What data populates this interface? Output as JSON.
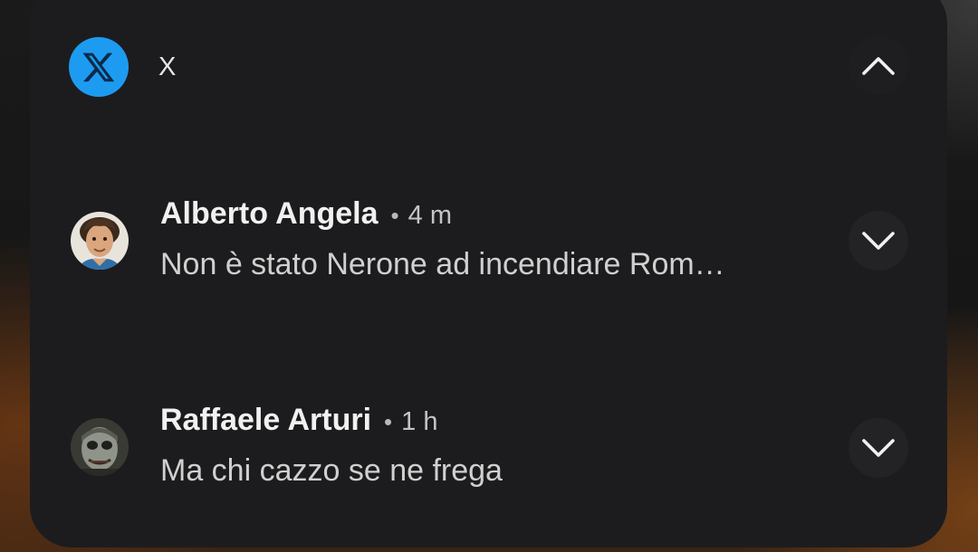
{
  "app": {
    "name": "X",
    "icon": "x-logo-icon",
    "icon_color": "#1d9bf0"
  },
  "controls": {
    "collapse_icon": "chevron-up-icon",
    "expand_icon": "chevron-down-icon"
  },
  "notifications": [
    {
      "sender": "Alberto Angela",
      "separator": "•",
      "time": "4 m",
      "message": "Non è stato Nerone ad incendiare Rom…",
      "avatar": "avatar-alberto-angela"
    },
    {
      "sender": "Raffaele Arturi",
      "separator": "•",
      "time": "1 h",
      "message": "Ma chi cazzo se ne frega",
      "avatar": "avatar-raffaele-arturi"
    }
  ]
}
